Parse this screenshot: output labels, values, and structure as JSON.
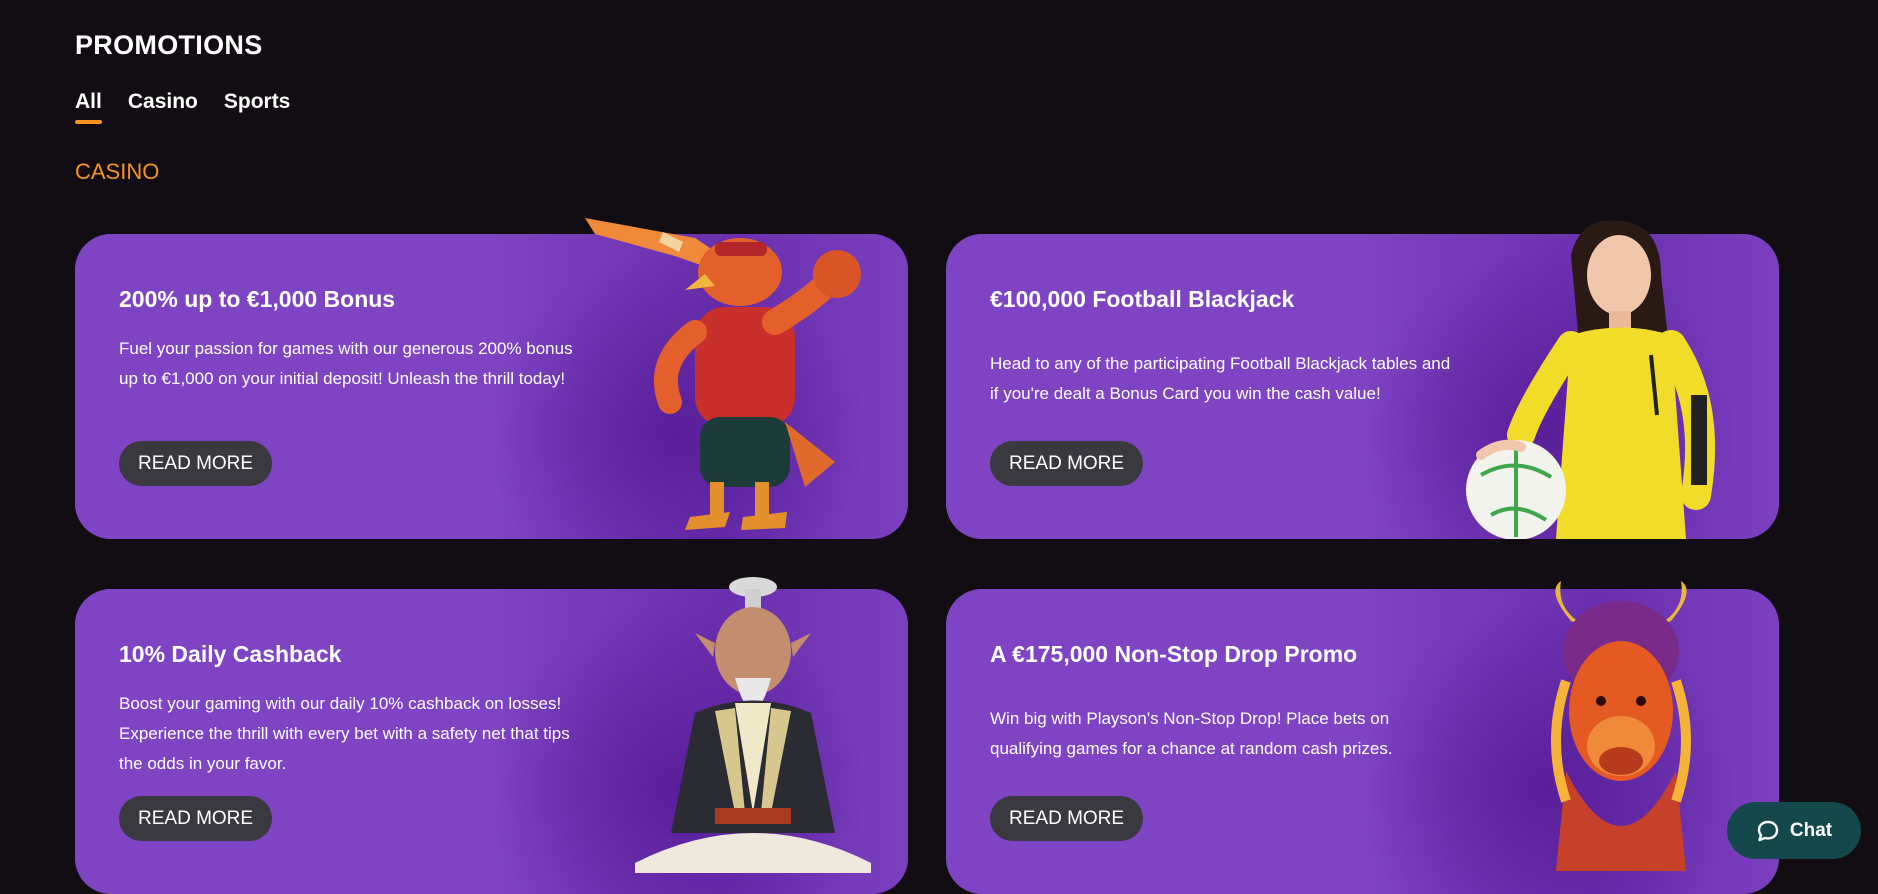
{
  "page": {
    "title": "PROMOTIONS"
  },
  "tabs": [
    {
      "label": "All",
      "active": true
    },
    {
      "label": "Casino",
      "active": false
    },
    {
      "label": "Sports",
      "active": false
    }
  ],
  "section": {
    "title": "CASINO"
  },
  "cards": [
    {
      "title": "200% up to €1,000 Bonus",
      "body": "Fuel your passion for games with our generous 200% bonus up to €1,000 on your initial deposit! Unleash the thrill today!",
      "button": "READ MORE",
      "art": "rooster-character"
    },
    {
      "title": "€100,000 Football Blackjack",
      "body": "Head to any of the participating Football Blackjack tables and if you're dealt a Bonus Card you win the cash value!",
      "button": "READ MORE",
      "art": "dealer-with-football"
    },
    {
      "title": "10% Daily Cashback",
      "body": "Boost your gaming with our daily 10% cashback on losses! Experience the thrill with every bet with a safety net that tips the odds in your favor.",
      "button": "READ MORE",
      "art": "sage-character"
    },
    {
      "title": "A €175,000 Non-Stop Drop Promo",
      "body": "Win big with Playson's Non-Stop Drop! Place bets on qualifying games for a chance at random cash prizes.",
      "button": "READ MORE",
      "art": "buffalo-character"
    }
  ],
  "chat": {
    "label": "Chat"
  },
  "colors": {
    "background": "#110d12",
    "card": "#7e44c3",
    "accent": "#f7931e",
    "chat": "#14484d"
  }
}
